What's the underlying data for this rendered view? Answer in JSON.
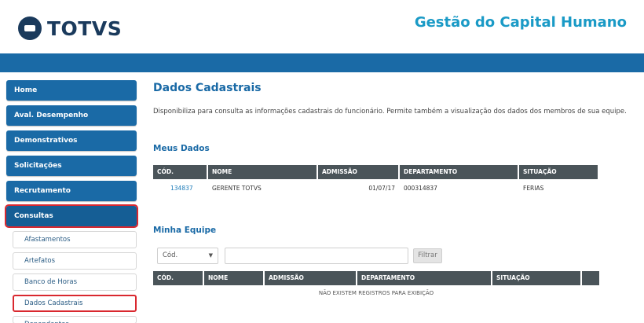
{
  "header": {
    "brand": "TOTVS",
    "app_title": "Gestão do Capital Humano",
    "logo_icon": "totvs-logo-icon",
    "accent_color": "#1a6aa6"
  },
  "sidebar": {
    "menu": [
      {
        "label": "Home"
      },
      {
        "label": "Aval. Desempenho"
      },
      {
        "label": "Demonstrativos"
      },
      {
        "label": "Solicitações"
      },
      {
        "label": "Recrutamento"
      },
      {
        "label": "Consultas"
      }
    ],
    "submenu": [
      {
        "label": "Afastamentos"
      },
      {
        "label": "Artefatos"
      },
      {
        "label": "Banco de Horas"
      },
      {
        "label": "Dados Cadastrais"
      },
      {
        "label": "Dependentes"
      }
    ]
  },
  "main": {
    "title": "Dados Cadastrais",
    "description": "Disponibiliza para consulta as informações cadastrais do funcionário. Permite também a visualização dos dados dos membros de sua equipe.",
    "meus_dados": {
      "title": "Meus Dados",
      "columns": [
        "CÓD.",
        "NOME",
        "ADMISSÃO",
        "DEPARTAMENTO",
        "SITUAÇÃO"
      ],
      "row": {
        "cod": "134837",
        "nome": "GERENTE TOTVS",
        "admissao": "01/07/17",
        "departamento": "000314837",
        "situacao": "FERIAS"
      }
    },
    "minha_equipe": {
      "title": "Minha Equipe",
      "filter_field": "Cód.",
      "filter_value": "",
      "filter_button": "Filtrar",
      "columns": [
        "CÓD.",
        "NOME",
        "ADMISSÃO",
        "DEPARTAMENTO",
        "SITUAÇÃO"
      ],
      "empty_message": "NÃO EXISTEM REGISTROS PARA EXIBIÇÃO"
    }
  }
}
